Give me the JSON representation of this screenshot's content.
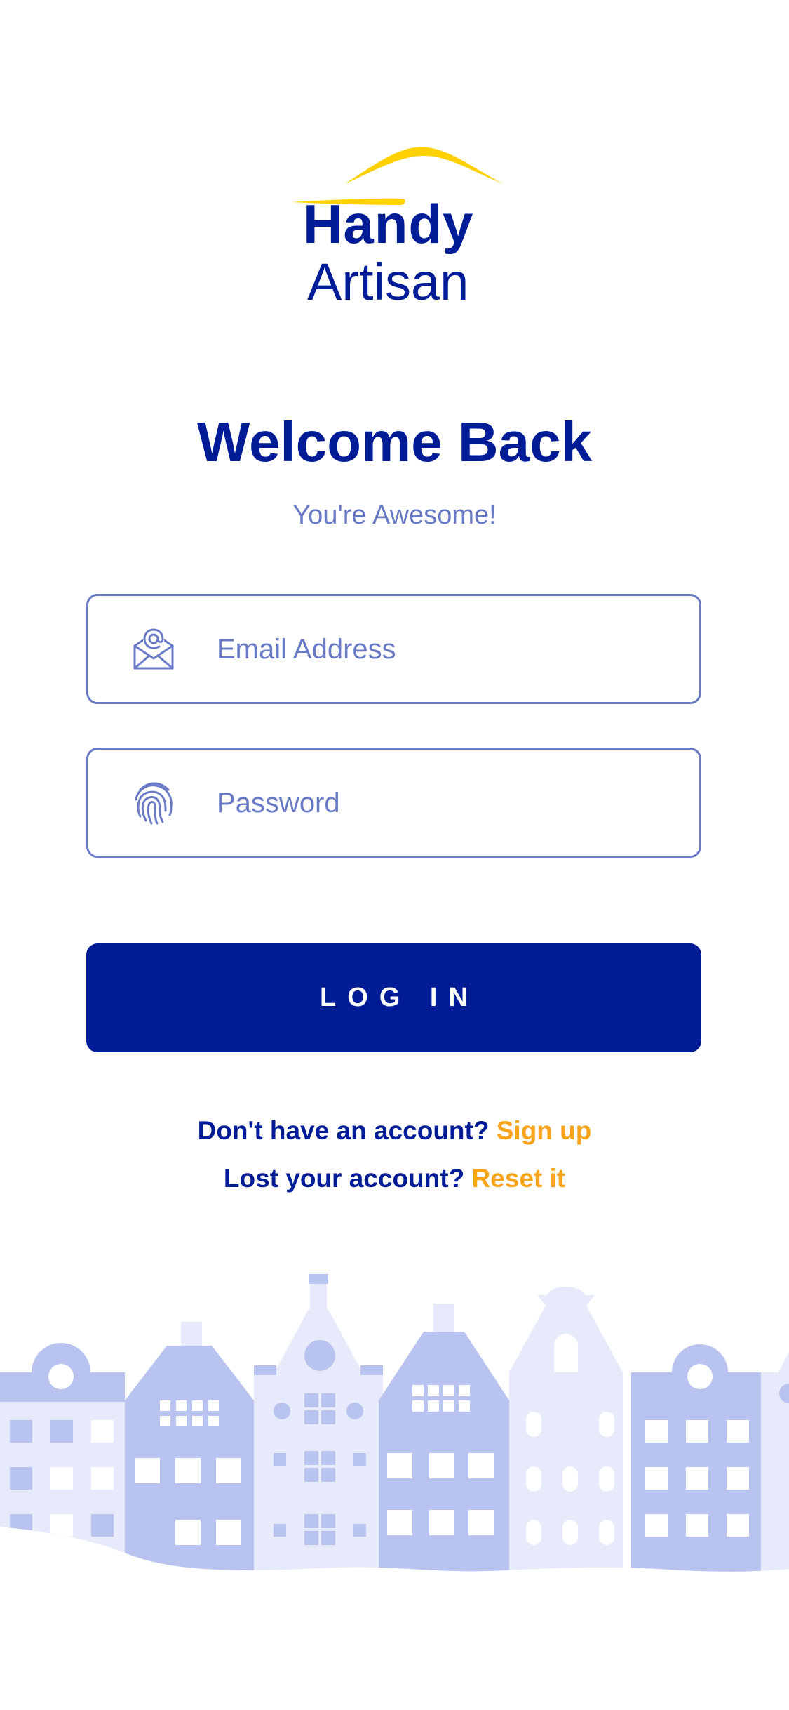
{
  "brand": {
    "word_1": "Handy",
    "word_2": "Artisan",
    "swoosh_color": "#ffd100",
    "text_color": "#001c96"
  },
  "header": {
    "title": "Welcome Back",
    "subtitle": "You're Awesome!"
  },
  "form": {
    "email": {
      "icon": "envelope-at-icon",
      "placeholder": "Email Address",
      "value": ""
    },
    "password": {
      "icon": "fingerprint-icon",
      "placeholder": "Password",
      "value": ""
    },
    "login_label": "LOG IN"
  },
  "links": {
    "signup_prompt": "Don't have an account?",
    "signup_link": "Sign up",
    "reset_prompt": "Lost your account?",
    "reset_link": "Reset it"
  },
  "colors": {
    "primary": "#001c96",
    "accent": "#f7a41b",
    "muted": "#6a7bc6",
    "town_dark": "#b8c3ef",
    "town_light": "#e6eafa"
  },
  "illustration": {
    "icon": "townhouses-illustration"
  }
}
